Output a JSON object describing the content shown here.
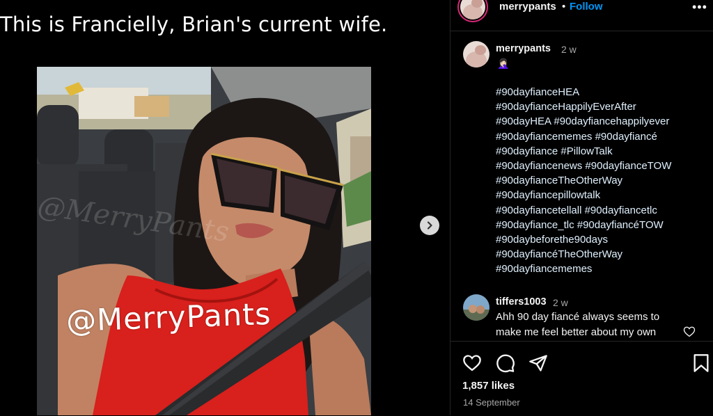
{
  "media": {
    "overlay_caption": "This is Francielly, Brian's current wife.",
    "watermark": "@MerryPants",
    "faint_watermark": "@MerryPants"
  },
  "header": {
    "username": "merrypants",
    "separator": "•",
    "follow_label": "Follow",
    "more_icon": "more-horizontal-icon"
  },
  "caption_comment": {
    "username": "merrypants",
    "time": "2 w",
    "emoji": "🤦🏻‍♀️",
    "hashtag_lines": [
      "#90dayfianceHEA",
      "#90dayfianceHappilyEverAfter",
      "#90dayHEA #90dayfiancehappilyever",
      "#90dayfiancememes #90dayfiancé",
      "#90dayfiance #PillowTalk",
      "#90dayfiancenews #90dayfianceTOW",
      "#90dayfianceTheOtherWay",
      "#90dayfiancepillowtalk",
      "#90dayfiancetellall #90dayfiancetlc",
      "#90dayfiance_tlc #90dayfiancéTOW",
      "#90daybeforethe90days",
      "#90dayfiancéTheOtherWay",
      "#90dayfiancememes"
    ]
  },
  "comment": {
    "username": "tiffers1003",
    "time": "2 w",
    "text": "Ahh 90 day fiancé always seems to make me feel better about my own"
  },
  "actions": {
    "likes": "1,857 likes",
    "date": "14 September",
    "icons": [
      "heart-icon",
      "comment-icon",
      "share-icon",
      "bookmark-icon"
    ]
  },
  "colors": {
    "background": "#000000",
    "follow_blue": "#0095f6",
    "hashtag": "#e0f1ff",
    "muted": "#a8a8a8",
    "dress_red": "#d8201c"
  }
}
